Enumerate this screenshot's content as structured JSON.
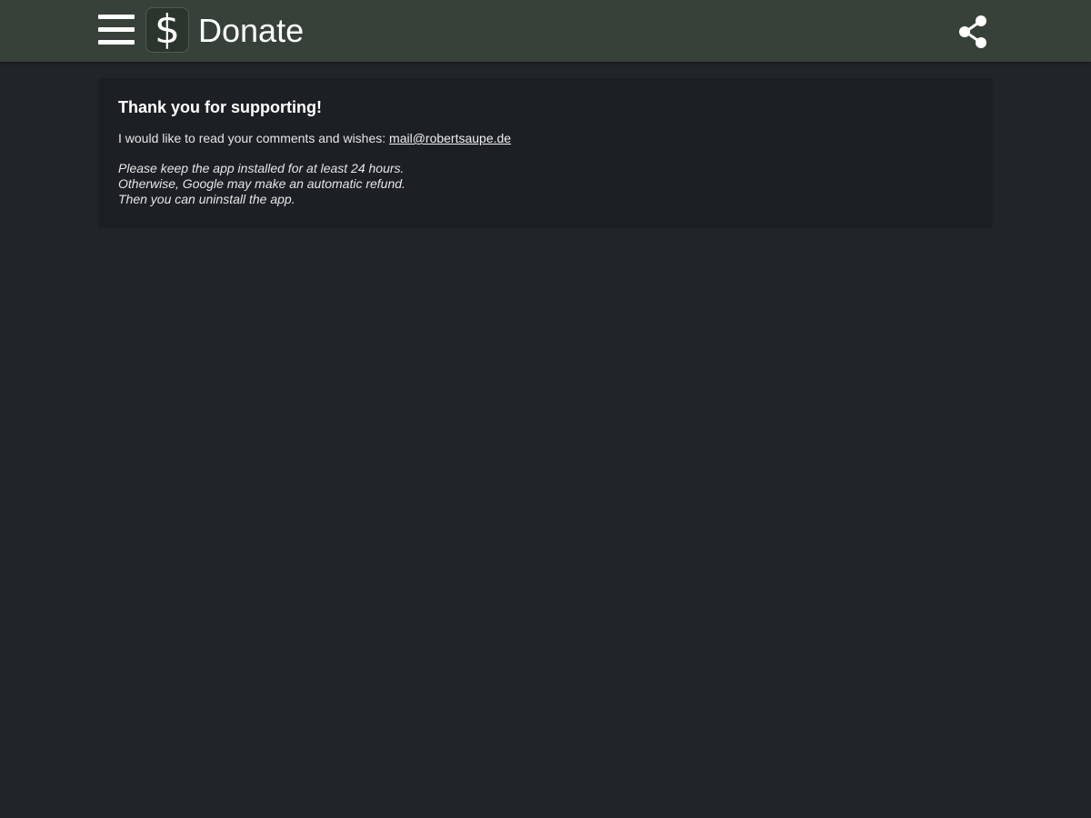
{
  "appbar": {
    "title": "Donate",
    "app_icon_glyph": "$",
    "menu_icon": "hamburger-menu-icon",
    "share_icon": "share-icon",
    "background_color": "#374139"
  },
  "content": {
    "heading": "Thank you for supporting!",
    "comments_text": "I would like to read your comments and wishes: ",
    "email": "mail@robertsaupe.de",
    "notes": [
      "Please keep the app installed for at least 24 hours.",
      "Otherwise, Google may make an automatic refund.",
      "Then you can uninstall the app."
    ]
  },
  "colors": {
    "page_background": "#212429",
    "card_background": "#1c1f23"
  }
}
